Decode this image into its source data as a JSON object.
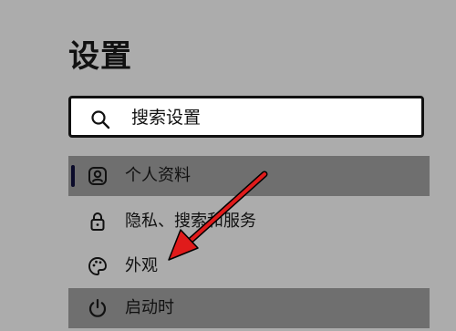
{
  "header": {
    "title": "设置"
  },
  "search": {
    "label": "搜索设置",
    "icon": "search-icon"
  },
  "sidebar": {
    "items": [
      {
        "label": "个人资料",
        "icon": "profile-icon",
        "state": "selected"
      },
      {
        "label": "隐私、搜索和服务",
        "icon": "lock-icon",
        "state": "normal"
      },
      {
        "label": "外观",
        "icon": "palette-icon",
        "state": "normal"
      },
      {
        "label": "启动时",
        "icon": "power-icon",
        "state": "hover"
      }
    ]
  },
  "annotation": {
    "type": "red-arrow",
    "color": "#e01b1b",
    "points_to": "外观"
  },
  "colors": {
    "background": "#acacac",
    "highlight": "#6f6f6f",
    "indicator": "#0b0b2a"
  }
}
